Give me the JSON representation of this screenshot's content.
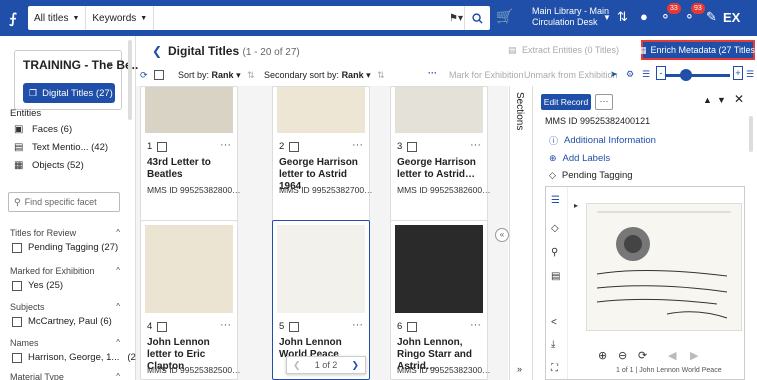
{
  "topbar": {
    "search_scope": "All titles",
    "search_field": "Keywords",
    "search_placeholder": "",
    "library": "Main Library - Main Circulation Desk",
    "notif_badge_1": "33",
    "notif_badge_2": "93",
    "user_initials": "EX"
  },
  "sidebar": {
    "set_title": "TRAINING - The Be..",
    "digital_titles_btn": "Digital Titles (27)",
    "entities_label": "Entities",
    "entities": [
      {
        "label": "Faces (6)"
      },
      {
        "label": "Text Mentio... (42)"
      },
      {
        "label": "Objects (52)"
      }
    ],
    "facet_search_placeholder": "Find specific facet",
    "facets": [
      {
        "head": "Titles for Review",
        "item": "Pending Tagging (27)"
      },
      {
        "head": "Marked for Exhibition",
        "item": "Yes (25)"
      },
      {
        "head": "Subjects",
        "item": "McCartney, Paul (6)"
      },
      {
        "head": "Names",
        "item": "Harrison, George, 1...",
        "count": "(2)"
      },
      {
        "head": "Material Type"
      }
    ]
  },
  "main": {
    "title": "Digital Titles",
    "count": "(1 - 20 of 27)",
    "extract_entities": "Extract Entities (0 Titles)",
    "enrich_metadata": "Enrich Metadata (27 Titles)",
    "sort_label": "Sort by:",
    "sort_value": "Rank",
    "secondary_sort_label": "Secondary sort by:",
    "secondary_sort_value": "Rank",
    "more_dots": "···",
    "mark_exhibition": "Mark for Exhibition",
    "unmark_exhibition": "Unmark from Exhibition",
    "slider_value": 0.25
  },
  "cards": [
    {
      "num": "1",
      "title": "43rd Letter to Beatles",
      "mms": "MMS ID 99525382800…"
    },
    {
      "num": "2",
      "title": "George Harrison letter to Astrid 1964",
      "mms": "MMS ID 99525382700…"
    },
    {
      "num": "3",
      "title": "George Harrison letter to Astrid…",
      "mms": "MMS ID 99525382600…"
    },
    {
      "num": "4",
      "title": "John Lennon letter to Eric Clapton",
      "mms": "MMS ID 99525382500…"
    },
    {
      "num": "5",
      "title": "John Lennon World Peace",
      "mms": ""
    },
    {
      "num": "6",
      "title": "John Lennon, Ringo Starr and Astrid…",
      "mms": "MMS ID 99525382300…"
    }
  ],
  "pager": {
    "text": "1 of 2"
  },
  "sections_label": "Sections",
  "panel": {
    "edit_record": "Edit Record",
    "mms_line": "MMS ID 99525382400121",
    "additional_info": "Additional Information",
    "add_labels": "Add Labels",
    "pending_tagging": "Pending Tagging",
    "viewer_caption": "1 of 1 | John Lennon World Peace"
  }
}
